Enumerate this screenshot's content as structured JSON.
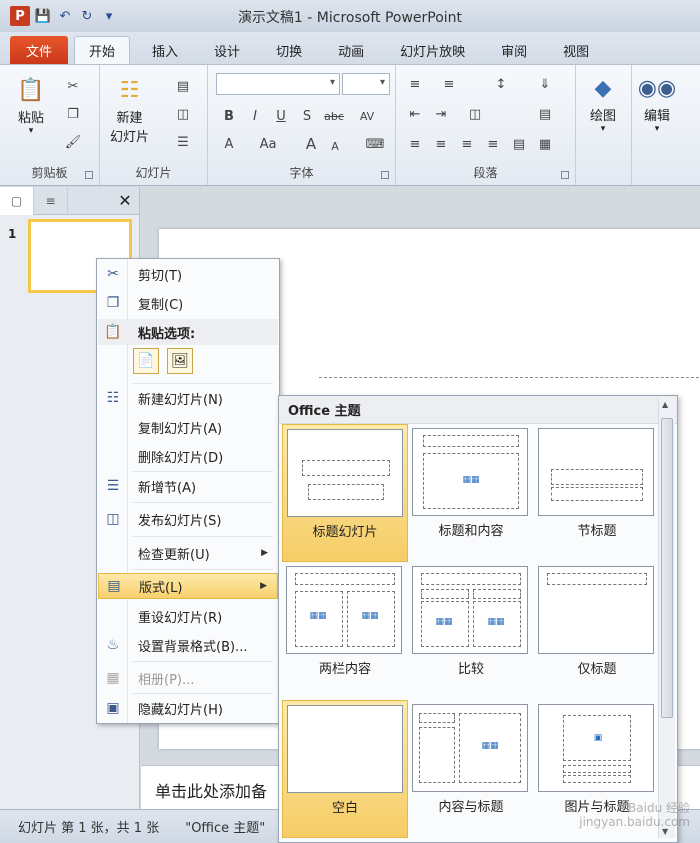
{
  "window": {
    "title": "演示文稿1 - Microsoft PowerPoint",
    "app_letter": "P"
  },
  "tabs": [
    "文件",
    "开始",
    "插入",
    "设计",
    "切换",
    "动画",
    "幻灯片放映",
    "审阅",
    "视图"
  ],
  "ribbon": {
    "clipboard": {
      "label": "剪贴板",
      "paste": "粘贴"
    },
    "slides": {
      "label": "幻灯片",
      "new_slide_1": "新建",
      "new_slide_2": "幻灯片"
    },
    "font": {
      "label": "字体",
      "bold": "B",
      "italic": "I",
      "underline": "U",
      "strike": "S",
      "abc": "abc",
      "av": "AV",
      "fontA": "A",
      "aa": "Aa",
      "grow": "A",
      "shrink": "A"
    },
    "paragraph": {
      "label": "段落"
    },
    "drawing": {
      "label": "绘图"
    },
    "editing": {
      "label": "编辑"
    }
  },
  "thumbnail": {
    "number": "1"
  },
  "notes": {
    "placeholder": "单击此处添加备"
  },
  "statusbar": {
    "slide_info": "幻灯片 第 1 张，共 1 张",
    "theme": "\"Office 主题\""
  },
  "context_menu": {
    "cut": "剪切(T)",
    "copy": "复制(C)",
    "paste_options": "粘贴选项:",
    "new_slide": "新建幻灯片(N)",
    "duplicate_slide": "复制幻灯片(A)",
    "delete_slide": "删除幻灯片(D)",
    "add_section": "新增节(A)",
    "publish_slides": "发布幻灯片(S)",
    "check_updates": "检查更新(U)",
    "layout": "版式(L)",
    "reset_slide": "重设幻灯片(R)",
    "format_background": "设置背景格式(B)...",
    "photo_album": "相册(P)...",
    "hide_slide": "隐藏幻灯片(H)"
  },
  "gallery": {
    "header": "Office 主题",
    "layouts": [
      "标题幻灯片",
      "标题和内容",
      "节标题",
      "两栏内容",
      "比较",
      "仅标题",
      "空白",
      "内容与标题",
      "图片与标题"
    ]
  },
  "watermark": {
    "line1": "Baidu 经验",
    "line2": "jingyan.baidu.com"
  },
  "colors": {
    "file_tab": "#c9381a",
    "highlight": "#f8d16e",
    "thumb_border": "#f5c84b"
  }
}
